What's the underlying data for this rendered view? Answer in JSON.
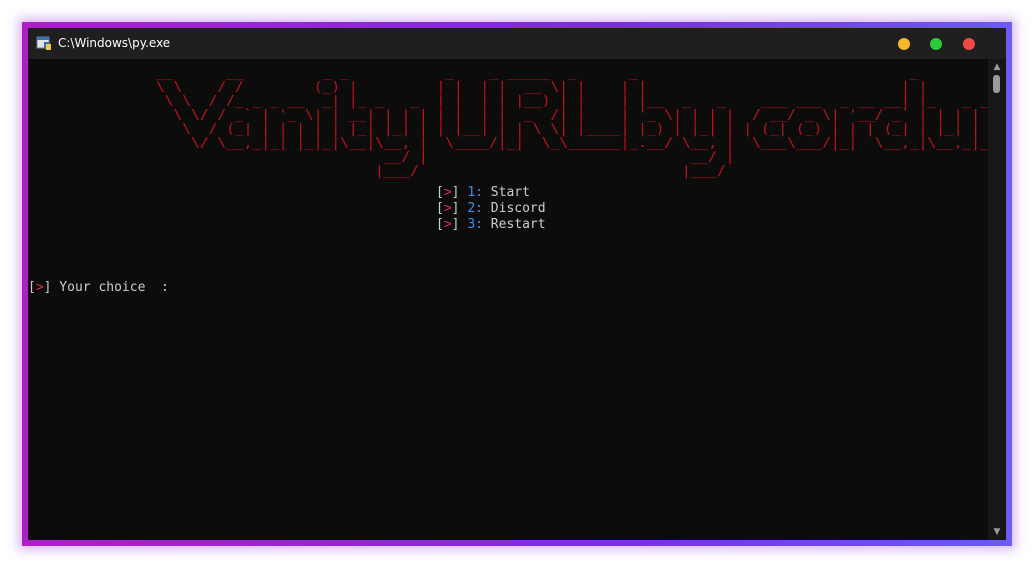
{
  "window": {
    "title": "C:\\Windows\\py.exe",
    "controls": {
      "minimize_color": "#f5b82c",
      "maximize_color": "#2dc83c",
      "close_color": "#f04848"
    }
  },
  "banner": {
    "text": "__      __         _ _           _    _ _____  _      _                               _                       \n\\ \\    / /        (_) |         | |  | |  __ \\| |    | |                             | |                      \n \\ \\  / /_ _ _ __  _| |_ _   _  | |  | | |__) | |    | |__  _   _    ___ ___  _ __ __| |_   _ _ __ ___ _   _ \n  \\ \\/ / _` | '_ \\| | __| | | | | |  | |  _  /| |    | '_ \\| | | |  / __/ _ \\| '__/ _` | | | | '__/ _ \\ | | |\n   \\  / (_| | | | | | |_| |_| | | |__| | | \\ \\| |____| |_) | |_| | | (_| (_) | | | (_| | |_| | | |  __/ |_| |\n    \\/ \\__,_|_| |_|_|\\__|\\__, |  \\____/|_|  \\_\\______|_.__/ \\__, |  \\___\\___/|_|  \\__,_|\\__,_|_|  \\___|\\__, |\n                          __/ |                              __/ |                                      __/ |\n                         |___/                              |___/                                      |___/ ",
    "color": "#c0121c"
  },
  "menu": {
    "items": [
      {
        "open": "[",
        "arrow": ">",
        "close": "]",
        "number": "1:",
        "label": "Start"
      },
      {
        "open": "[",
        "arrow": ">",
        "close": "]",
        "number": "2:",
        "label": "Discord"
      },
      {
        "open": "[",
        "arrow": ">",
        "close": "]",
        "number": "3:",
        "label": "Restart"
      }
    ]
  },
  "prompt": {
    "open": "[",
    "arrow": ">",
    "close": "]",
    "text": " Your choice  :"
  },
  "colors": {
    "background": "#0c0c0c",
    "text": "#cccccc",
    "accent_red": "#e03040",
    "number_blue": "#3b8eea",
    "frame_gradient_start": "#b01ec8",
    "frame_gradient_end": "#6a5cf5"
  },
  "icons": {
    "app": "python-console-icon",
    "scroll_up": "chevron-up-icon",
    "scroll_down": "chevron-down-icon"
  }
}
